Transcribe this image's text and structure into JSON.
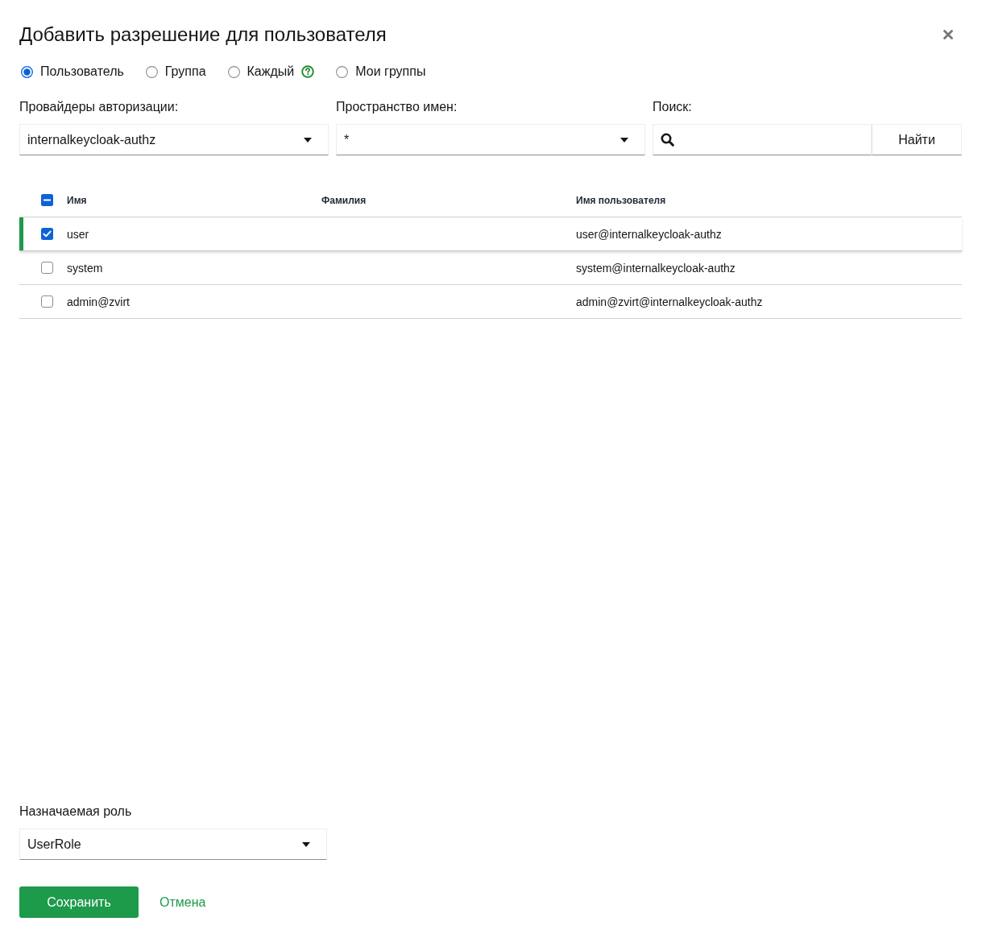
{
  "dialog": {
    "title": "Добавить разрешение для пользователя"
  },
  "principal_types": [
    {
      "label": "Пользователь",
      "selected": true,
      "help": false
    },
    {
      "label": "Группа",
      "selected": false,
      "help": false
    },
    {
      "label": "Каждый",
      "selected": false,
      "help": true
    },
    {
      "label": "Мои группы",
      "selected": false,
      "help": false
    }
  ],
  "filters": [
    {
      "kind": "select",
      "label": "Провайдеры авторизации:",
      "value": "internalkeycloak-authz"
    },
    {
      "kind": "select",
      "label": "Пространство имен:",
      "value": "*"
    },
    {
      "kind": "search",
      "label": "Поиск:",
      "button": "Найти"
    }
  ],
  "table": {
    "select_all": {
      "checked": false,
      "indeterminate": true
    },
    "columns": [
      "Имя",
      "Фамилия",
      "Имя пользователя"
    ],
    "rows": [
      {
        "first_name": "user",
        "user_name": "user@internalkeycloak-authz",
        "selected": true
      },
      {
        "first_name": "system",
        "user_name": "system@internalkeycloak-authz",
        "selected": false
      },
      {
        "first_name": "admin@zvirt",
        "user_name": "admin@zvirt@internalkeycloak-authz",
        "selected": false
      }
    ]
  },
  "role": {
    "label": "Назначаемая роль",
    "value": "UserRole"
  },
  "buttons": [
    {
      "label": "Сохранить",
      "kind": "primary"
    },
    {
      "label": "Отмена",
      "kind": "link"
    }
  ]
}
